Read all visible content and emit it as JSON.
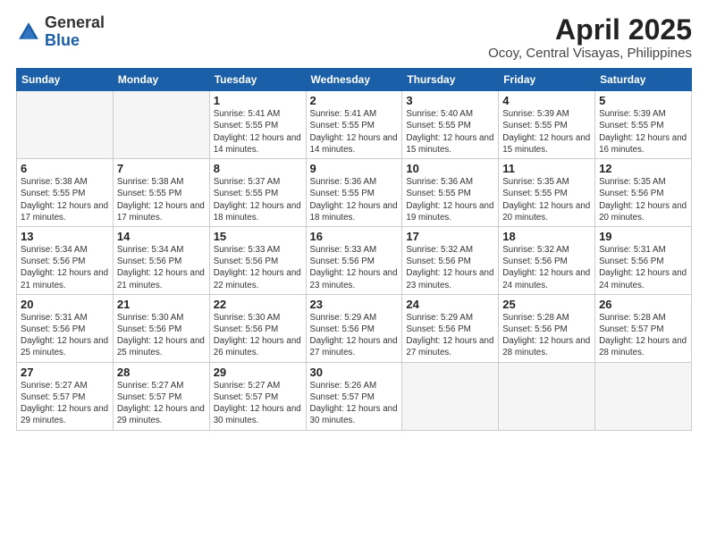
{
  "header": {
    "logo_general": "General",
    "logo_blue": "Blue",
    "title": "April 2025",
    "subtitle": "Ocoy, Central Visayas, Philippines"
  },
  "columns": [
    "Sunday",
    "Monday",
    "Tuesday",
    "Wednesday",
    "Thursday",
    "Friday",
    "Saturday"
  ],
  "weeks": [
    [
      {
        "day": "",
        "info": ""
      },
      {
        "day": "",
        "info": ""
      },
      {
        "day": "1",
        "info": "Sunrise: 5:41 AM\nSunset: 5:55 PM\nDaylight: 12 hours and 14 minutes."
      },
      {
        "day": "2",
        "info": "Sunrise: 5:41 AM\nSunset: 5:55 PM\nDaylight: 12 hours and 14 minutes."
      },
      {
        "day": "3",
        "info": "Sunrise: 5:40 AM\nSunset: 5:55 PM\nDaylight: 12 hours and 15 minutes."
      },
      {
        "day": "4",
        "info": "Sunrise: 5:39 AM\nSunset: 5:55 PM\nDaylight: 12 hours and 15 minutes."
      },
      {
        "day": "5",
        "info": "Sunrise: 5:39 AM\nSunset: 5:55 PM\nDaylight: 12 hours and 16 minutes."
      }
    ],
    [
      {
        "day": "6",
        "info": "Sunrise: 5:38 AM\nSunset: 5:55 PM\nDaylight: 12 hours and 17 minutes."
      },
      {
        "day": "7",
        "info": "Sunrise: 5:38 AM\nSunset: 5:55 PM\nDaylight: 12 hours and 17 minutes."
      },
      {
        "day": "8",
        "info": "Sunrise: 5:37 AM\nSunset: 5:55 PM\nDaylight: 12 hours and 18 minutes."
      },
      {
        "day": "9",
        "info": "Sunrise: 5:36 AM\nSunset: 5:55 PM\nDaylight: 12 hours and 18 minutes."
      },
      {
        "day": "10",
        "info": "Sunrise: 5:36 AM\nSunset: 5:55 PM\nDaylight: 12 hours and 19 minutes."
      },
      {
        "day": "11",
        "info": "Sunrise: 5:35 AM\nSunset: 5:55 PM\nDaylight: 12 hours and 20 minutes."
      },
      {
        "day": "12",
        "info": "Sunrise: 5:35 AM\nSunset: 5:56 PM\nDaylight: 12 hours and 20 minutes."
      }
    ],
    [
      {
        "day": "13",
        "info": "Sunrise: 5:34 AM\nSunset: 5:56 PM\nDaylight: 12 hours and 21 minutes."
      },
      {
        "day": "14",
        "info": "Sunrise: 5:34 AM\nSunset: 5:56 PM\nDaylight: 12 hours and 21 minutes."
      },
      {
        "day": "15",
        "info": "Sunrise: 5:33 AM\nSunset: 5:56 PM\nDaylight: 12 hours and 22 minutes."
      },
      {
        "day": "16",
        "info": "Sunrise: 5:33 AM\nSunset: 5:56 PM\nDaylight: 12 hours and 23 minutes."
      },
      {
        "day": "17",
        "info": "Sunrise: 5:32 AM\nSunset: 5:56 PM\nDaylight: 12 hours and 23 minutes."
      },
      {
        "day": "18",
        "info": "Sunrise: 5:32 AM\nSunset: 5:56 PM\nDaylight: 12 hours and 24 minutes."
      },
      {
        "day": "19",
        "info": "Sunrise: 5:31 AM\nSunset: 5:56 PM\nDaylight: 12 hours and 24 minutes."
      }
    ],
    [
      {
        "day": "20",
        "info": "Sunrise: 5:31 AM\nSunset: 5:56 PM\nDaylight: 12 hours and 25 minutes."
      },
      {
        "day": "21",
        "info": "Sunrise: 5:30 AM\nSunset: 5:56 PM\nDaylight: 12 hours and 25 minutes."
      },
      {
        "day": "22",
        "info": "Sunrise: 5:30 AM\nSunset: 5:56 PM\nDaylight: 12 hours and 26 minutes."
      },
      {
        "day": "23",
        "info": "Sunrise: 5:29 AM\nSunset: 5:56 PM\nDaylight: 12 hours and 27 minutes."
      },
      {
        "day": "24",
        "info": "Sunrise: 5:29 AM\nSunset: 5:56 PM\nDaylight: 12 hours and 27 minutes."
      },
      {
        "day": "25",
        "info": "Sunrise: 5:28 AM\nSunset: 5:56 PM\nDaylight: 12 hours and 28 minutes."
      },
      {
        "day": "26",
        "info": "Sunrise: 5:28 AM\nSunset: 5:57 PM\nDaylight: 12 hours and 28 minutes."
      }
    ],
    [
      {
        "day": "27",
        "info": "Sunrise: 5:27 AM\nSunset: 5:57 PM\nDaylight: 12 hours and 29 minutes."
      },
      {
        "day": "28",
        "info": "Sunrise: 5:27 AM\nSunset: 5:57 PM\nDaylight: 12 hours and 29 minutes."
      },
      {
        "day": "29",
        "info": "Sunrise: 5:27 AM\nSunset: 5:57 PM\nDaylight: 12 hours and 30 minutes."
      },
      {
        "day": "30",
        "info": "Sunrise: 5:26 AM\nSunset: 5:57 PM\nDaylight: 12 hours and 30 minutes."
      },
      {
        "day": "",
        "info": ""
      },
      {
        "day": "",
        "info": ""
      },
      {
        "day": "",
        "info": ""
      }
    ]
  ]
}
